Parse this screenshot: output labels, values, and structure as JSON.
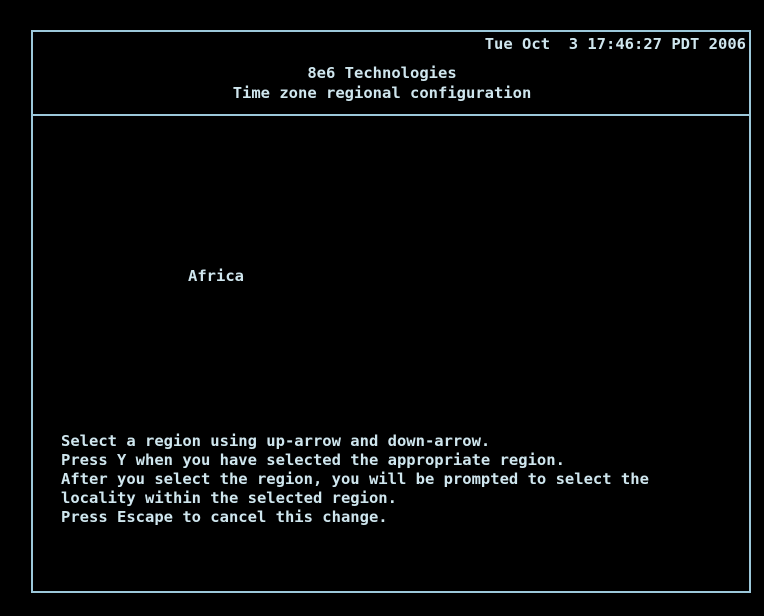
{
  "header": {
    "datetime": "Tue Oct  3 17:46:27 PDT 2006",
    "company": "8e6 Technologies",
    "title": "Time zone regional configuration"
  },
  "regions": {
    "selected": "Africa"
  },
  "instructions": [
    "Select a region using up-arrow and down-arrow.",
    "Press Y when you have selected the appropriate region.",
    "After you select the region, you will be prompted to select the",
    "locality within the selected region.",
    "Press Escape to cancel this change."
  ],
  "colors": {
    "background": "#000000",
    "text": "#cfe6ee",
    "border": "#9cc8da"
  }
}
